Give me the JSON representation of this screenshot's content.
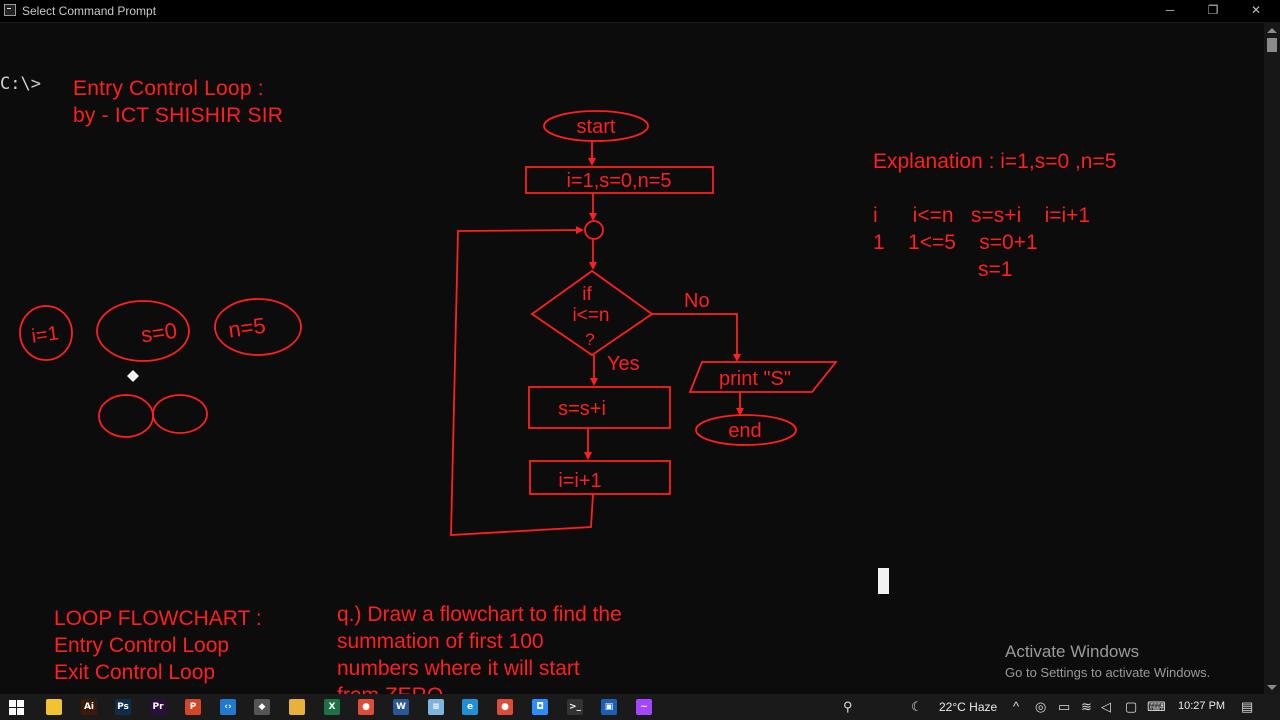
{
  "window": {
    "title": "Select Command Prompt",
    "controls": [
      "─",
      "❐",
      "✕"
    ]
  },
  "console": {
    "prompt": "C:\\>",
    "heading": [
      "Entry Control Loop :",
      "by - ICT SHISHIR SIR"
    ],
    "loop_notes": [
      "LOOP FLOWCHART :",
      "Entry Control Loop",
      "Exit Control Loop"
    ],
    "question": [
      "q.) Draw a flowchart to find the",
      "summation of first 100",
      "numbers where it will start",
      "from ZERO."
    ],
    "explanation": [
      "Explanation : i=1,s=0 ,n=5",
      "",
      "i      i<=n   s=s+i    i=i+1",
      "1    1<=5    s=0+1",
      "                  s=1"
    ],
    "sketch_labels": [
      "i=1",
      "s=0",
      "n=5"
    ]
  },
  "flowchart": {
    "start": "start",
    "init": "i=1,s=0,n=5",
    "decision": [
      "if",
      "i<=n",
      "?"
    ],
    "yes": "Yes",
    "no": "No",
    "sum": "s=s+i",
    "incr": "i=i+1",
    "print": "print \"S\"",
    "end": "end"
  },
  "watermark": {
    "line1": "Activate Windows",
    "line2": "Go to Settings to activate Windows."
  },
  "taskbar": {
    "apps": [
      {
        "name": "file-explorer-icon",
        "color": "#f2c230",
        "glyph": ""
      },
      {
        "name": "illustrator-icon",
        "color": "#3b1a08",
        "glyph": "Ai"
      },
      {
        "name": "photoshop-icon",
        "color": "#0d2d4a",
        "glyph": "Ps"
      },
      {
        "name": "premiere-icon",
        "color": "#2a0f3e",
        "glyph": "Pr"
      },
      {
        "name": "powerpoint-icon",
        "color": "#d24726",
        "glyph": "P"
      },
      {
        "name": "vscode-icon",
        "color": "#1f7ad0",
        "glyph": "‹›"
      },
      {
        "name": "network-tool-icon",
        "color": "#555555",
        "glyph": "◆"
      },
      {
        "name": "folder-icon",
        "color": "#e8b23a",
        "glyph": ""
      },
      {
        "name": "excel-icon",
        "color": "#1e7145",
        "glyph": "X"
      },
      {
        "name": "chrome-icon",
        "color": "#dd4b39",
        "glyph": "●"
      },
      {
        "name": "word-icon",
        "color": "#2b579a",
        "glyph": "W"
      },
      {
        "name": "notepad-icon",
        "color": "#7fb4dc",
        "glyph": "≡"
      },
      {
        "name": "edge-icon",
        "color": "#1f8fd6",
        "glyph": "e"
      },
      {
        "name": "chrome-2-icon",
        "color": "#dd4b39",
        "glyph": "●"
      },
      {
        "name": "zoom-icon",
        "color": "#2d8cff",
        "glyph": "◘"
      },
      {
        "name": "terminal-icon",
        "color": "#333333",
        "glyph": ">_"
      },
      {
        "name": "screen-tool-icon",
        "color": "#1a5fb4",
        "glyph": "▣"
      },
      {
        "name": "messenger-icon",
        "color": "#a246ff",
        "glyph": "~"
      }
    ],
    "weather": "22°C  Haze",
    "time": "10:27 PM"
  }
}
